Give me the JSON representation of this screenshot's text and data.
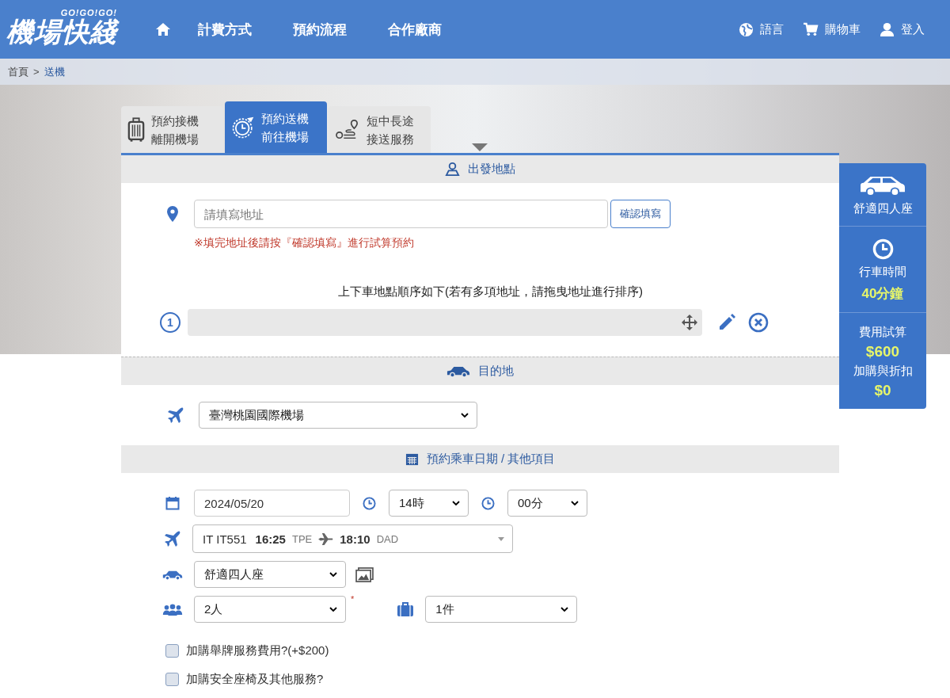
{
  "header": {
    "logo": "機場快綫",
    "logo_tagline": "GO!GO!GO!",
    "nav": [
      "計費方式",
      "預約流程",
      "合作廠商"
    ],
    "actions": [
      {
        "kind": "language",
        "label": "語言"
      },
      {
        "kind": "cart",
        "label": "購物車"
      },
      {
        "kind": "login",
        "label": "登入"
      }
    ]
  },
  "breadcrumb": [
    {
      "label": "首頁",
      "current": false
    },
    {
      "label": "送機",
      "current": true
    }
  ],
  "breadcrumb_separator": ">",
  "tabs": [
    {
      "kind": "pickup",
      "line1": "預約接機",
      "line2": "離開機場",
      "selected": false
    },
    {
      "kind": "dropoff",
      "line1": "預約送機",
      "line2": "前往機場",
      "selected": true
    },
    {
      "kind": "charter",
      "line1": "短中長途",
      "line2": "接送服務",
      "selected": false
    }
  ],
  "departure": {
    "title": "出發地點",
    "address": {
      "placeholder": "請填寫地址"
    },
    "confirm_button": "確認填寫",
    "note": "※填完地址後請按『確認填寫』進行試算預約",
    "order_title": "上下車地點順序如下(若有多項地址，請拖曳地址進行排序)",
    "stops": [
      {
        "number": "1"
      }
    ]
  },
  "destination": {
    "title": "目的地",
    "airport": "臺灣桃園國際機場"
  },
  "booking": {
    "title": "預約乘車日期 / 其他項目",
    "date": "2024/05/20",
    "hour": "14時",
    "minute": "00分",
    "flight": {
      "code": "IT IT551",
      "depart_time": "16:25",
      "depart_airport": "TPE",
      "arrive_time": "18:10",
      "arrive_airport": "DAD"
    },
    "car_type": "舒適四人座",
    "passengers": "2人",
    "required_mark": "*",
    "luggage": "1件",
    "options": [
      {
        "label": "加購舉牌服務費用?(+$200)",
        "checked": false
      },
      {
        "label": "加購安全座椅及其他服務?",
        "checked": false
      }
    ]
  },
  "summary": {
    "car": "舒適四人座",
    "time_label": "行車時間",
    "time_value": "40分鐘",
    "fee_label": "費用試算",
    "fee_value": "$600",
    "extra_label": "加購與折扣",
    "extra_value": "$0"
  }
}
